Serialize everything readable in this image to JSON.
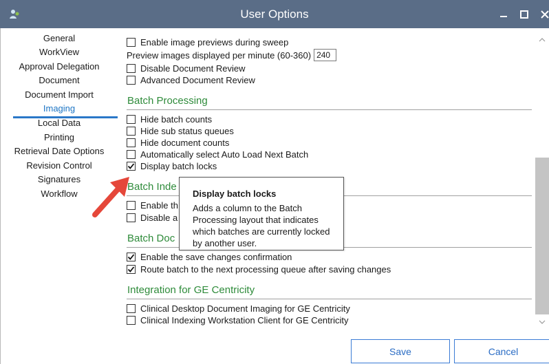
{
  "window": {
    "title": "User Options",
    "titlebar_color": "#5a6d87",
    "controls": [
      "minimize-icon",
      "maximize-icon",
      "close-icon"
    ]
  },
  "nav": {
    "items": [
      {
        "label": "General"
      },
      {
        "label": "WorkView"
      },
      {
        "label": "Approval Delegation"
      },
      {
        "label": "Document"
      },
      {
        "label": "Document Import"
      },
      {
        "label": "Imaging",
        "active": true
      },
      {
        "label": "Local Data"
      },
      {
        "label": "Printing"
      },
      {
        "label": "Retrieval Date Options"
      },
      {
        "label": "Revision Control"
      },
      {
        "label": "Signatures"
      },
      {
        "label": "Workflow"
      }
    ]
  },
  "imaging": {
    "enable_previews": {
      "label": "Enable image previews during sweep",
      "checked": false
    },
    "preview_rate": {
      "label": "Preview images displayed per minute (60-360)",
      "value": "240"
    },
    "disable_review": {
      "label": "Disable Document Review",
      "checked": false
    },
    "advanced_review": {
      "label": "Advanced Document Review",
      "checked": false
    }
  },
  "batch_processing": {
    "heading": "Batch Processing",
    "options": [
      {
        "label": "Hide batch counts",
        "checked": false
      },
      {
        "label": "Hide sub status queues",
        "checked": false
      },
      {
        "label": "Hide document counts",
        "checked": false
      },
      {
        "label": "Automatically select Auto Load Next Batch",
        "checked": false
      },
      {
        "label": "Display batch locks",
        "checked": true
      }
    ]
  },
  "batch_index": {
    "heading": "Batch Inde",
    "options": [
      {
        "label": "Enable th",
        "checked": false
      },
      {
        "label": "Disable a",
        "checked": false
      }
    ]
  },
  "batch_doc": {
    "heading": "Batch Doc",
    "options": [
      {
        "label": "Enable the save changes confirmation",
        "checked": true
      },
      {
        "label": "Route batch to the next processing queue after saving changes",
        "checked": true
      }
    ]
  },
  "ge_centricity": {
    "heading": "Integration for GE Centricity",
    "options": [
      {
        "label": "Clinical Desktop Document Imaging for GE Centricity",
        "checked": false
      },
      {
        "label": "Clinical Indexing Workstation Client for GE Centricity",
        "checked": false
      }
    ]
  },
  "tooltip": {
    "title": "Display batch locks",
    "body": "Adds a column to the Batch Processing layout that indicates which batches are currently locked by another user."
  },
  "buttons": {
    "save": "Save",
    "cancel": "Cancel"
  },
  "colors": {
    "section_heading": "#2e8b3a",
    "active_nav": "#1b74c4",
    "annotation_arrow": "#e5473a"
  }
}
